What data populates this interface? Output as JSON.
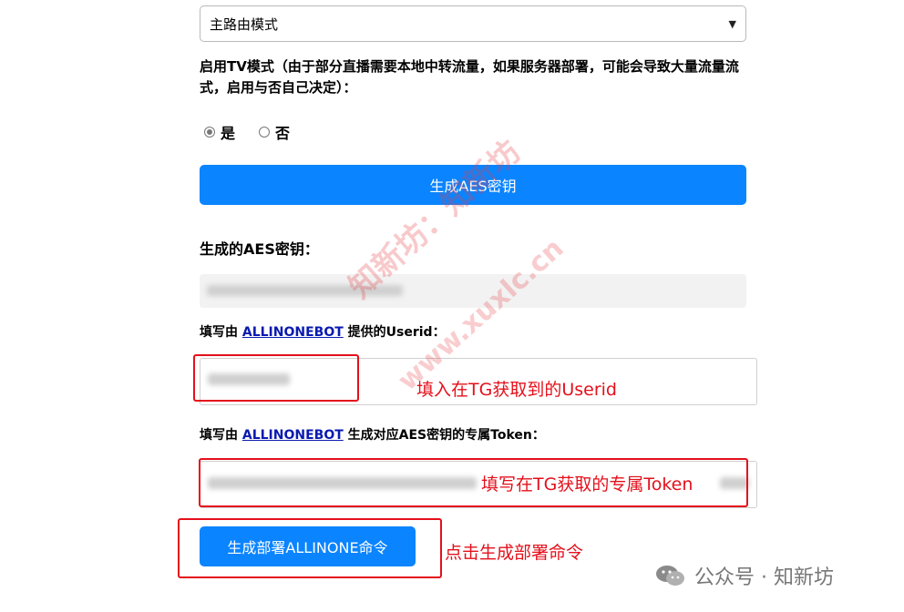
{
  "route_select": {
    "value": "主路由模式"
  },
  "tv_mode": {
    "label": "启用TV模式（由于部分直播需要本地中转流量，如果服务器部署，可能会导致大量流量流式，启用与否自己决定）：",
    "options": [
      "是",
      "否"
    ],
    "selected": "是"
  },
  "buttons": {
    "generate_aes": "生成AES密钥",
    "generate_command": "生成部署ALLINONE命令"
  },
  "aes_section": {
    "title": "生成的AES密钥："
  },
  "userid_section": {
    "prefix": "填写由",
    "link": "ALLINONEBOT",
    "suffix": "提供的Userid："
  },
  "token_section": {
    "prefix": "填写由",
    "link": "ALLINONEBOT",
    "suffix": "生成对应AES密钥的专属Token："
  },
  "annotations": {
    "userid_note": "填入在TG获取到的Userid",
    "token_note": "填写在TG获取的专属Token",
    "command_note": "点击生成部署命令"
  },
  "watermark": {
    "line1": "知新坊：知新坊",
    "line2": "www.xuxlc.cn"
  },
  "brand": {
    "text": "公众号 · 知新坊"
  },
  "colors": {
    "primary": "#0a84ff",
    "annotation": "#e4101b",
    "link": "#0a1ab0"
  }
}
